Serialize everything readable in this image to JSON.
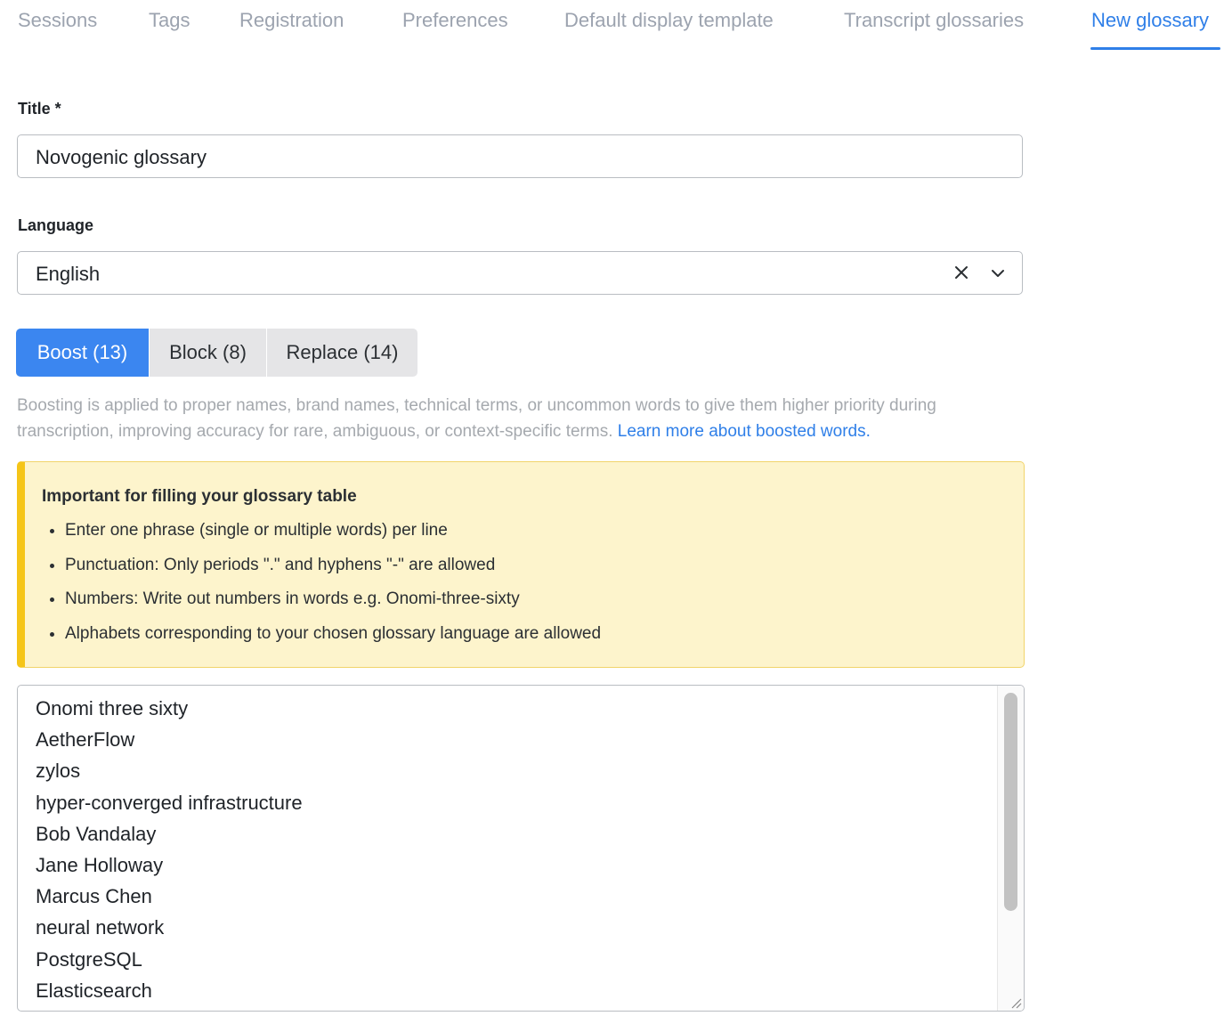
{
  "tabs": [
    {
      "label": "Sessions"
    },
    {
      "label": "Tags"
    },
    {
      "label": "Registration"
    },
    {
      "label": "Preferences"
    },
    {
      "label": "Default display template"
    },
    {
      "label": "Transcript glossaries"
    },
    {
      "label": "New glossary"
    }
  ],
  "form": {
    "title_label": "Title *",
    "title_value": "Novogenic glossary",
    "language_label": "Language",
    "language_value": "English"
  },
  "segments": [
    {
      "label": "Boost (13)"
    },
    {
      "label": "Block (8)"
    },
    {
      "label": "Replace (14)"
    }
  ],
  "help": {
    "text": "Boosting is applied to proper names, brand names, technical terms, or uncommon words to give them higher priority during transcription, improving accuracy for rare, ambiguous, or context-specific terms.",
    "link": "Learn more about boosted words."
  },
  "notice": {
    "title": "Important for filling your glossary table",
    "items": [
      "Enter one phrase (single or multiple words) per line",
      "Punctuation: Only periods \".\" and hyphens \"-\" are allowed",
      "Numbers: Write out numbers in words e.g. Onomi-three-sixty",
      "Alphabets corresponding to your chosen glossary language are allowed"
    ]
  },
  "glossary_lines": [
    "Onomi three sixty",
    "AetherFlow",
    "zylos",
    "hyper-converged infrastructure",
    "Bob Vandalay",
    "Jane Holloway",
    "Marcus Chen",
    "neural network",
    "PostgreSQL",
    "Elasticsearch"
  ],
  "colors": {
    "accent": "#2f7fe8",
    "notice_bg": "#fdf4cc",
    "notice_border": "#f5c518"
  }
}
